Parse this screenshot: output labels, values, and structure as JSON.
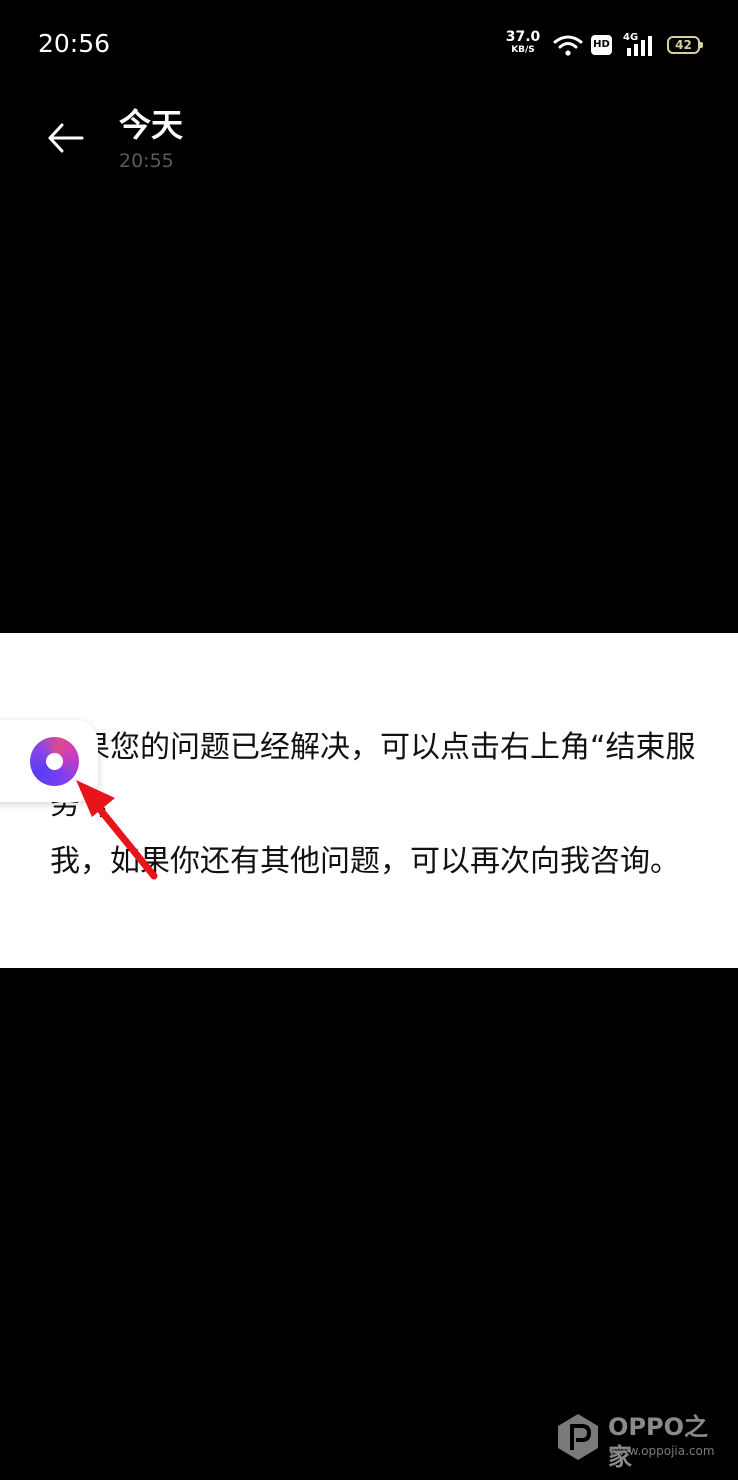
{
  "status_bar": {
    "time": "20:56",
    "net_speed_value": "37.0",
    "net_speed_unit": "KB/S",
    "hd_label": "HD",
    "network_type": "4G",
    "battery_level": "42",
    "icons": [
      "wifi-icon",
      "hd-icon",
      "signal-icon",
      "battery-icon"
    ]
  },
  "header": {
    "back_icon": "back-arrow-icon",
    "title": "今天",
    "subtitle": "20:55"
  },
  "message": {
    "text": "如果您的问题已经解决，可以点击右上角“结束服务”，\n我，如果你还有其他问题，可以再次向我咨询。"
  },
  "floating_ball": {
    "icon": "floating-assistant-ball-icon"
  },
  "annotation": {
    "icon": "red-pointer-arrow-icon",
    "color": "#e8141c"
  },
  "watermark": {
    "brand": "OPPO之家",
    "url": "www.oppojia.com"
  }
}
